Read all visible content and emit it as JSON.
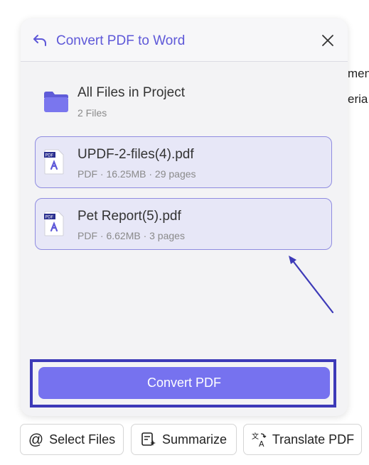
{
  "background": {
    "line1": "men",
    "line2": "eria"
  },
  "panel": {
    "header": {
      "title": "Convert PDF to Word",
      "accent": "#5e58d8"
    },
    "project": {
      "title": "All Files in Project",
      "count": "2 Files"
    },
    "files": [
      {
        "name": "UPDF-2-files(4).pdf",
        "meta": "PDF · 16.25MB · 29 pages"
      },
      {
        "name": "Pet Report(5).pdf",
        "meta": "PDF · 6.62MB · 3 pages"
      }
    ],
    "convert_button": {
      "label": "Convert PDF",
      "color": "#7672ef"
    }
  },
  "actions": [
    {
      "label": "Select Files",
      "icon": "at-icon"
    },
    {
      "label": "Summarize",
      "icon": "summarize-icon"
    },
    {
      "label": "Translate PDF",
      "icon": "translate-icon"
    }
  ]
}
